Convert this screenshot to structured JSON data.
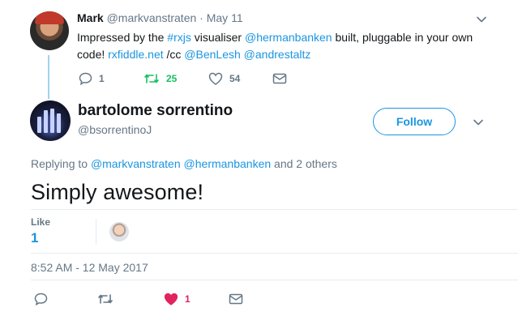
{
  "parent_tweet": {
    "name": "Mark",
    "handle": "@markvanstraten",
    "separator": "·",
    "date": "May 11",
    "text_parts": [
      {
        "t": "Impressed by the ",
        "link": false
      },
      {
        "t": "#rxjs",
        "link": true
      },
      {
        "t": " visualiser ",
        "link": false
      },
      {
        "t": "@hermanbanken",
        "link": true
      },
      {
        "t": " built, pluggable in your own code! ",
        "link": false
      },
      {
        "t": "rxfiddle.net",
        "link": true
      },
      {
        "t": " /cc ",
        "link": false
      },
      {
        "t": "@BenLesh",
        "link": true
      },
      {
        "t": " ",
        "link": false
      },
      {
        "t": "@andrestaltz",
        "link": true
      }
    ],
    "reply_count": "1",
    "retweet_count": "25",
    "like_count": "54"
  },
  "main_tweet": {
    "name": "bartolome sorrentino",
    "handle": "@bsorrentinoJ",
    "follow_label": "Follow",
    "replying_prefix": "Replying to",
    "replying_to_1": "@markvanstraten",
    "replying_to_2": "@hermanbanken",
    "replying_suffix": "and 2 others",
    "text": "Simply awesome!",
    "likes_label": "Like",
    "likes_count": "1",
    "timestamp": "8:52 AM - 12 May 2017",
    "heart_count": "1"
  },
  "icons": {
    "reply": "reply-icon",
    "retweet": "retweet-icon",
    "like": "heart-icon",
    "dm": "envelope-icon",
    "more": "chevron-down-icon"
  },
  "colors": {
    "link": "#1b95e0",
    "retweet_active": "#17bf63",
    "heart_active": "#e0245e",
    "muted": "#657786"
  }
}
